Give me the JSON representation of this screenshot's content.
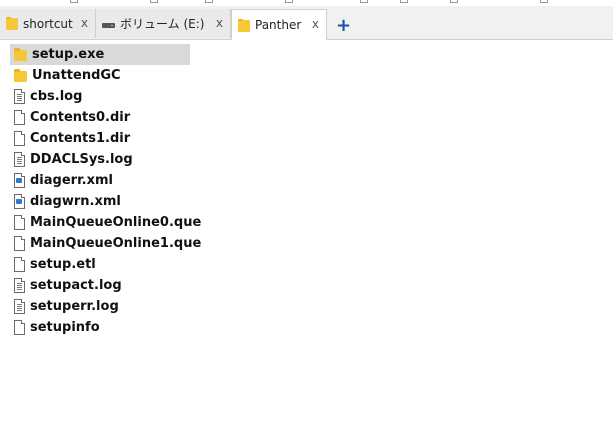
{
  "tabs": [
    {
      "label": "shortcut",
      "icon": "folder-icon",
      "close": "x",
      "active": false
    },
    {
      "label": "ボリューム (E:)",
      "icon": "drive-icon",
      "close": "x",
      "active": false
    },
    {
      "label": "Panther",
      "icon": "folder-icon",
      "close": "x",
      "active": true
    }
  ],
  "add_tab_label": "+",
  "files": [
    {
      "name": "setup.exe",
      "type": "folder",
      "selected": true
    },
    {
      "name": "UnattendGC",
      "type": "folder"
    },
    {
      "name": "cbs.log",
      "type": "text"
    },
    {
      "name": "Contents0.dir",
      "type": "doc"
    },
    {
      "name": "Contents1.dir",
      "type": "doc"
    },
    {
      "name": "DDACLSys.log",
      "type": "text"
    },
    {
      "name": "diagerr.xml",
      "type": "xml"
    },
    {
      "name": "diagwrn.xml",
      "type": "xml"
    },
    {
      "name": "MainQueueOnline0.que",
      "type": "doc"
    },
    {
      "name": "MainQueueOnline1.que",
      "type": "doc"
    },
    {
      "name": "setup.etl",
      "type": "doc"
    },
    {
      "name": "setupact.log",
      "type": "text"
    },
    {
      "name": "setuperr.log",
      "type": "text"
    },
    {
      "name": "setupinfo",
      "type": "doc"
    }
  ],
  "colors": {
    "accent": "#1a4fb0",
    "selection": "#d9d9d9",
    "folder": "#f5c83a"
  }
}
